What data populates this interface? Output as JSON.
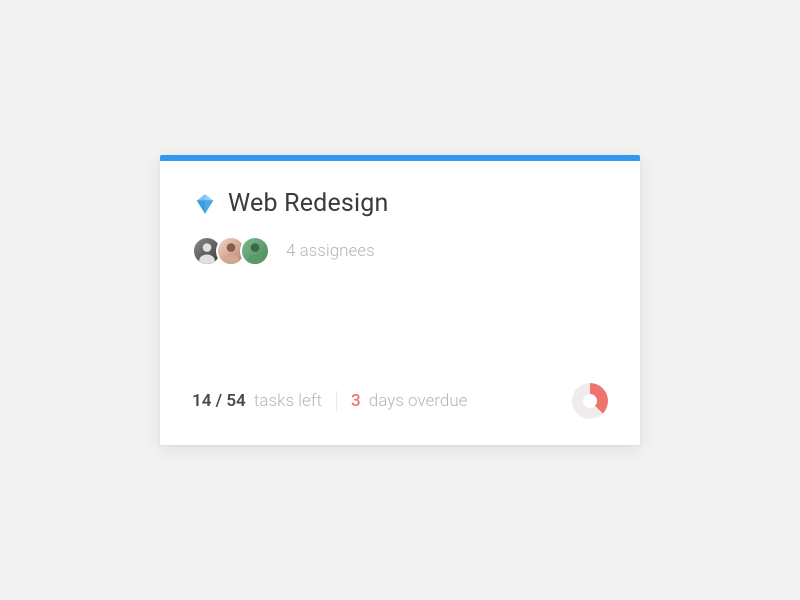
{
  "card": {
    "accent_color": "#3498f0",
    "title": "Web Redesign",
    "icon_name": "diamond-icon",
    "assignees_label": "4 assignees",
    "tasks_count": "14 / 54",
    "tasks_label": "tasks left",
    "overdue_count": "3",
    "overdue_label": "days overdue",
    "progress_fraction": 0.375,
    "progress_color": "#f0746e"
  }
}
